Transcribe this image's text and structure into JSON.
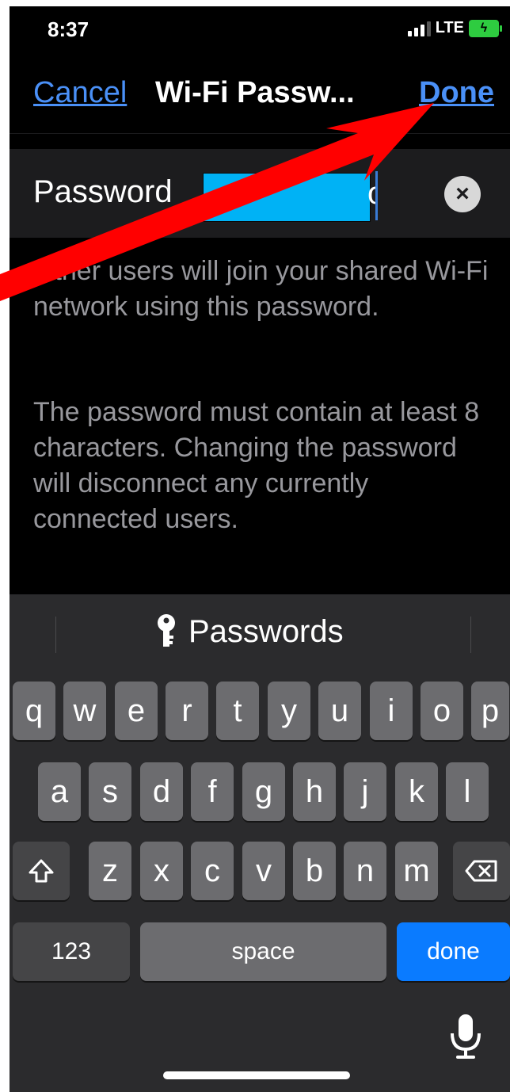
{
  "status": {
    "time": "8:37",
    "network": "LTE"
  },
  "nav": {
    "cancel_label": "Cancel",
    "title": "Wi-Fi Passw...",
    "done_label": "Done"
  },
  "field": {
    "label": "Password",
    "value_tail": "o",
    "clear_icon": "×"
  },
  "description": {
    "para1": "Other users will join your shared Wi-Fi network using this password.",
    "para2": "The password must contain at least 8 characters. Changing the password will disconnect any currently connected users."
  },
  "keyboard": {
    "suggestion_label": "Passwords",
    "row1": [
      "q",
      "w",
      "e",
      "r",
      "t",
      "y",
      "u",
      "i",
      "o",
      "p"
    ],
    "row2": [
      "a",
      "s",
      "d",
      "f",
      "g",
      "h",
      "j",
      "k",
      "l"
    ],
    "row3": [
      "z",
      "x",
      "c",
      "v",
      "b",
      "n",
      "m"
    ],
    "numbers_label": "123",
    "space_label": "space",
    "done_label": "done"
  },
  "colors": {
    "accent": "#4a90f7",
    "done_key": "#0a7bff",
    "annotation_arrow": "#ff0000"
  }
}
